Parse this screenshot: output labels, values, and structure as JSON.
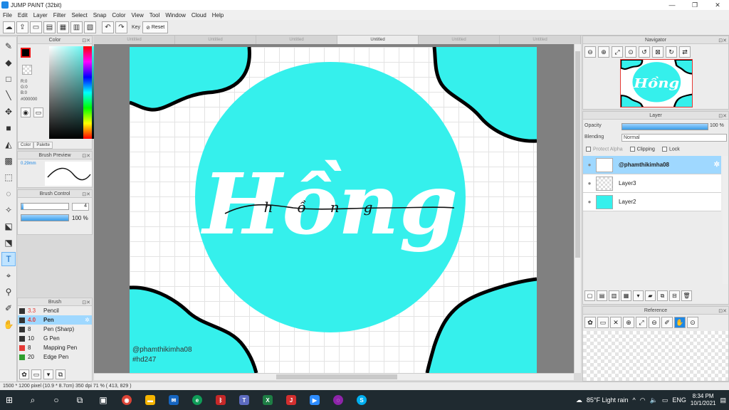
{
  "window": {
    "title": "JUMP PAINT (32bit)",
    "minimize": "—",
    "maximize": "❐",
    "close": "✕"
  },
  "menu": [
    "File",
    "Edit",
    "Layer",
    "Filter",
    "Select",
    "Snap",
    "Color",
    "View",
    "Tool",
    "Window",
    "Cloud",
    "Help"
  ],
  "toolbar": {
    "key_label": "Key",
    "reset_label": "Reset"
  },
  "tabs": [
    "Untitled",
    "Untitled",
    "Untitled",
    "Untitled",
    "Untitled",
    "Untitled"
  ],
  "active_tab_index": 3,
  "color_panel": {
    "title": "Color",
    "rgb": "R:0\nG:0\nB:0",
    "hex": "#000000",
    "tab_color": "Color",
    "tab_palette": "Palette",
    "foreground": "#000000"
  },
  "brush_preview": {
    "title": "Brush Preview",
    "size": "0.29mm"
  },
  "brush_control": {
    "title": "Brush Control",
    "size_value": "4",
    "opacity_value": "100 %"
  },
  "brush_panel": {
    "title": "Brush",
    "items": [
      {
        "size": "3.3",
        "name": "Pencil",
        "color": "#333333"
      },
      {
        "size": "4.0",
        "name": "Pen",
        "color": "#333333"
      },
      {
        "size": "8",
        "name": "Pen (Sharp)",
        "color": "#333333"
      },
      {
        "size": "10",
        "name": "G Pen",
        "color": "#333333"
      },
      {
        "size": "8",
        "name": "Mapping Pen",
        "color": "#e53935"
      },
      {
        "size": "20",
        "name": "Edge Pen",
        "color": "#2e9e2e"
      }
    ]
  },
  "canvas": {
    "accent": "#35f0ec",
    "text_main": "Hồng",
    "signature_text": "hồng",
    "credit_user": "@phamthikimha08",
    "credit_tag": "#hd247"
  },
  "navigator": {
    "title": "Navigator"
  },
  "layer_panel": {
    "title": "Layer",
    "opacity_label": "Opacity",
    "opacity_value": "100 %",
    "blending_label": "Blending",
    "blending_value": "Normal",
    "protect_alpha": "Protect Alpha",
    "clipping": "Clipping",
    "lock": "Lock",
    "layers": [
      "@phamthikimha08",
      "Layer3",
      "Layer2"
    ]
  },
  "reference": {
    "title": "Reference"
  },
  "status": "1500 * 1200 pixel   (10.9 * 8.7cm)   350 dpi   71 %   ( 413, 829 )",
  "taskbar": {
    "weather": "85°F  Light rain",
    "lang": "ENG",
    "time": "8:34 PM",
    "date": "10/1/2021"
  }
}
